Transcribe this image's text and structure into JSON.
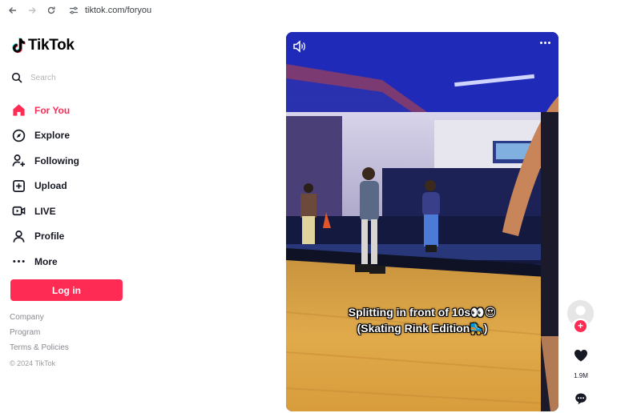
{
  "browser": {
    "url": "tiktok.com/foryou"
  },
  "sidebar": {
    "logo_text": "TikTok",
    "search_placeholder": "Search",
    "items": [
      {
        "label": "For You",
        "icon": "home-icon",
        "active": true
      },
      {
        "label": "Explore",
        "icon": "compass-icon",
        "active": false
      },
      {
        "label": "Following",
        "icon": "user-plus-icon",
        "active": false
      },
      {
        "label": "Upload",
        "icon": "plus-square-icon",
        "active": false
      },
      {
        "label": "LIVE",
        "icon": "live-camera-icon",
        "active": false
      },
      {
        "label": "Profile",
        "icon": "person-icon",
        "active": false
      },
      {
        "label": "More",
        "icon": "ellipsis-icon",
        "active": false
      }
    ],
    "login_label": "Log in",
    "footer_links": [
      "Company",
      "Program",
      "Terms & Policies"
    ],
    "copyright": "© 2024 TikTok"
  },
  "video": {
    "caption_line1": "Splitting in front of 10s👀😍",
    "caption_line2": "(Skating Rink Edition🛼)"
  },
  "actions": {
    "follow_symbol": "+",
    "like_count": "1.9M"
  },
  "colors": {
    "accent": "#fe2c55",
    "text": "#161823",
    "muted": "#8a8b91"
  }
}
